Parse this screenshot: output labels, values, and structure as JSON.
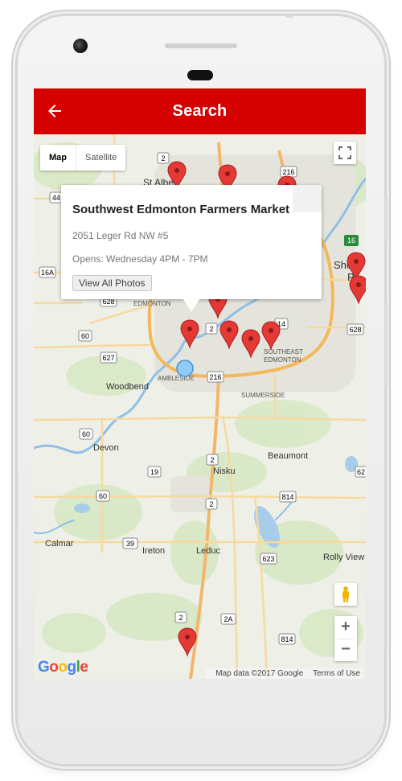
{
  "appbar": {
    "title": "Search",
    "back_icon": "arrow-left-icon",
    "color": "#d50000"
  },
  "map_controls": {
    "map_label": "Map",
    "satellite_label": "Satellite"
  },
  "info_window": {
    "title": "Southwest Edmonton Farmers Market",
    "address": "2051 Leger Rd NW #5",
    "hours": "Opens: Wednesday 4PM - 7PM",
    "button_label": "View All Photos"
  },
  "map_labels": {
    "st_albert": "St Albert",
    "edmonton": "EDMONTON",
    "southeast_edmonton_1": "SOUTHEAST",
    "southeast_edmonton_2": "EDMONTON",
    "ambleside": "AMBLESIDE",
    "summerside": "SUMMERSIDE",
    "woodbend": "Woodbend",
    "devon": "Devon",
    "nisku": "Nisku",
    "beaumont": "Beaumont",
    "calmar": "Calmar",
    "ireton": "Ireton",
    "leduc": "Leduc",
    "rolly_view": "Rolly View",
    "she": "She",
    "p": "P"
  },
  "road_shields": [
    "2",
    "216",
    "44",
    "16A",
    "628",
    "60",
    "627",
    "2",
    "14",
    "216",
    "628",
    "60",
    "19",
    "2",
    "60",
    "814",
    "2",
    "39",
    "623",
    "2",
    "2A",
    "814",
    "16",
    "62"
  ],
  "attribution": {
    "google": "Google",
    "map_data": "Map data ©2017 Google",
    "terms": "Terms of Use"
  },
  "zoom": {
    "plus": "+",
    "minus": "−"
  },
  "accent_colors": {
    "marker": "#e53935",
    "location_dot": "#90caf9"
  }
}
